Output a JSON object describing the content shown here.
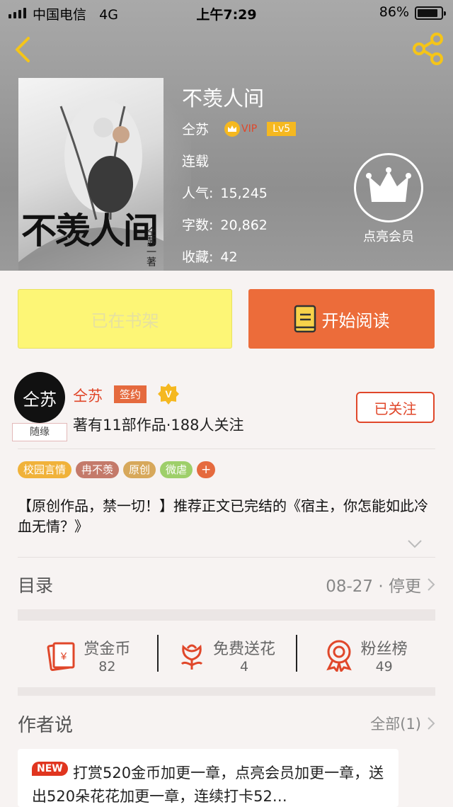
{
  "status_bar": {
    "carrier": "中国电信",
    "network": "4G",
    "time": "上午7:29",
    "battery": "86%",
    "battery_level": 0.86
  },
  "header": {
    "back_icon": "chevron-left-icon",
    "share_icon": "share-icon"
  },
  "book": {
    "cover_title": "不羡人间",
    "cover_author": "仝苏一著",
    "title": "不羡人间",
    "author": "仝苏",
    "vip": "VIP",
    "level": "Lv5",
    "status": "连载",
    "popularity_label": "人气:",
    "popularity": "15,245",
    "words_label": "字数:",
    "words": "20,862",
    "favorites_label": "收藏:",
    "favorites": "42",
    "member_label": "点亮会员"
  },
  "buttons": {
    "shelf": "已在书架",
    "read": "开始阅读"
  },
  "author_card": {
    "avatar_text": "仝苏",
    "avatar_tag": "随缘",
    "name": "仝苏",
    "signed": "签约",
    "verified": "V",
    "stats": "著有11部作品·188人关注",
    "follow": "已关注"
  },
  "tags": [
    {
      "label": "校园言情",
      "color": "#f0b23a"
    },
    {
      "label": "冉不羡",
      "color": "#c47a6a"
    },
    {
      "label": "原创",
      "color": "#d7a85b"
    },
    {
      "label": "微虐",
      "color": "#9ecf6a"
    }
  ],
  "tag_add": "+",
  "intro": "【原创作品，禁一切！】推荐正文已完结的《宿主，你怎能如此冷血无情？》",
  "toc": {
    "title": "目录",
    "update": "08-27 · 停更"
  },
  "actions": [
    {
      "label": "赏金币",
      "count": "82",
      "icon": "red-envelope-icon"
    },
    {
      "label": "免费送花",
      "count": "4",
      "icon": "flower-icon"
    },
    {
      "label": "粉丝榜",
      "count": "49",
      "icon": "medal-icon"
    }
  ],
  "author_say": {
    "title": "作者说",
    "all": "全部(1)",
    "new_badge": "NEW",
    "text": "打赏520金币加更一章，点亮会员加更一章，送出520朵花花加更一章，连续打卡52…"
  },
  "colors": {
    "accent": "#ec6c3a",
    "red": "#e0472a",
    "shelf_yellow": "#fdf676",
    "gold": "#f5b820"
  }
}
